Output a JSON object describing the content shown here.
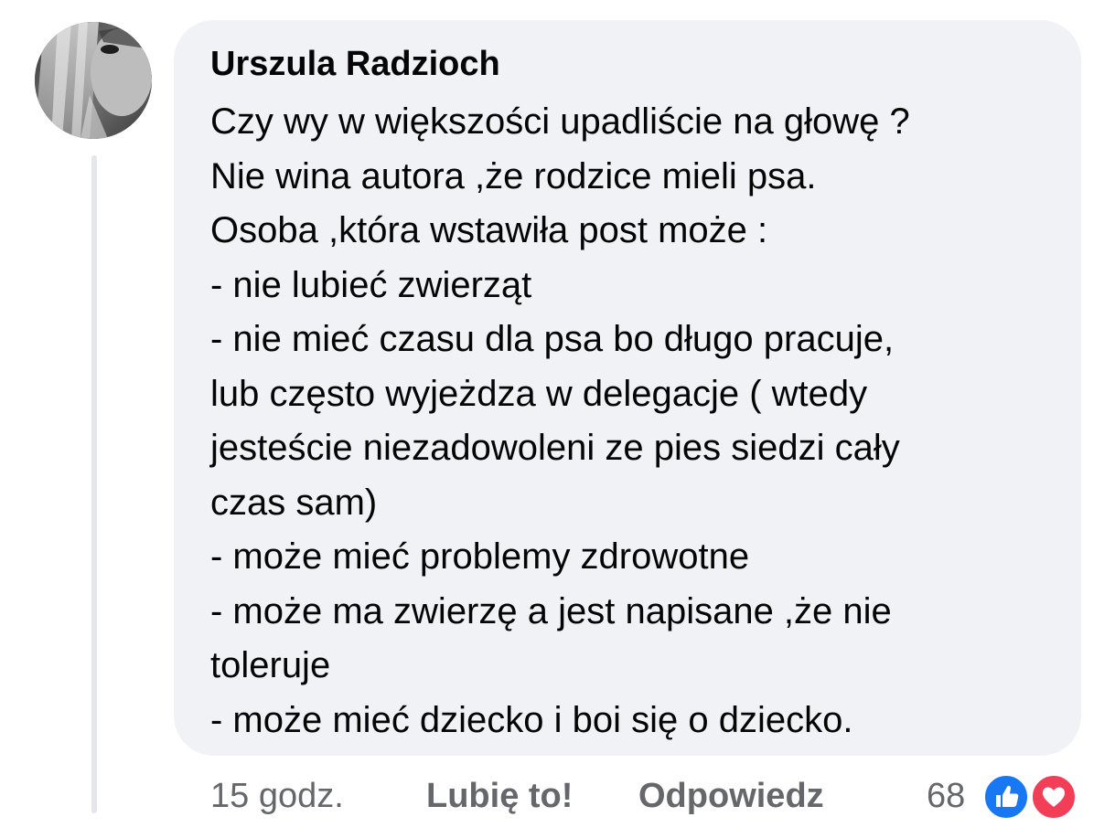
{
  "comment": {
    "author": "Urszula Radzioch",
    "lines": [
      "Czy wy w większości upadliście na głowę ?",
      "Nie wina autora ,że rodzice mieli psa.",
      "Osoba ,która wstawiła post może :",
      "- nie lubieć zwierząt",
      "- nie mieć czasu dla psa bo długo pracuje,",
      "lub często wyjeżdza w delegacje ( wtedy",
      "jesteście niezadowoleni ze pies siedzi cały",
      "czas sam)",
      "- może mieć problemy zdrowotne",
      "- może ma zwierzę a jest napisane ,że nie",
      "toleruje",
      "- może mieć dziecko i boi się o dziecko."
    ]
  },
  "footer": {
    "time": "15 godz.",
    "like_label": "Lubię to!",
    "reply_label": "Odpowiedz",
    "reaction_count": "68"
  },
  "reactions": [
    "like-icon",
    "love-icon"
  ],
  "colors": {
    "bubble": "#f0f2f5",
    "meta_text": "#65676b",
    "like_blue": "#1877f2",
    "love_red": "#f33e58",
    "thread_line": "#e4e6eb"
  }
}
